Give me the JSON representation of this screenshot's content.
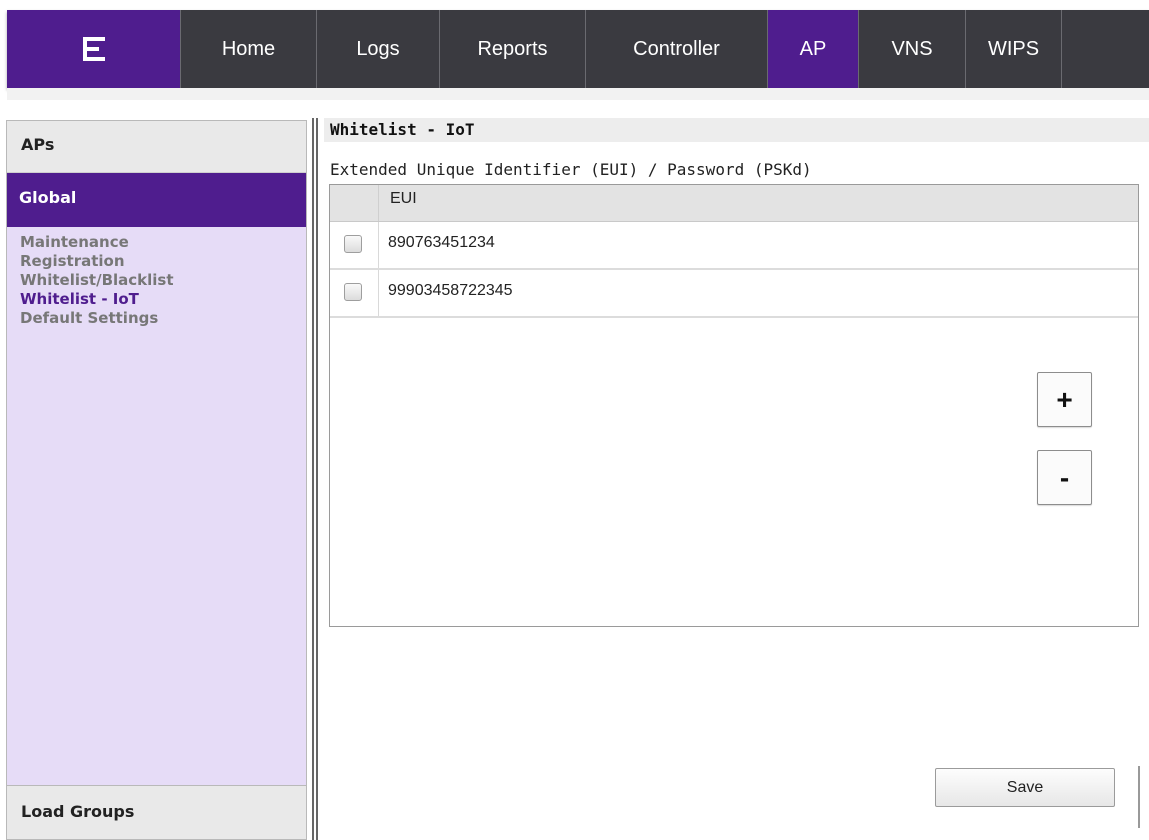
{
  "nav": {
    "logo_icon": "extreme-networks-logo",
    "tabs": [
      {
        "label": "Home",
        "active": false
      },
      {
        "label": "Logs",
        "active": false
      },
      {
        "label": "Reports",
        "active": false
      },
      {
        "label": "Controller",
        "active": false
      },
      {
        "label": "AP",
        "active": true
      },
      {
        "label": "VNS",
        "active": false
      },
      {
        "label": "WIPS",
        "active": false
      }
    ],
    "colors": {
      "bar": "#3a3a40",
      "accent": "#4f1d8e"
    }
  },
  "sidebar": {
    "section_title": "APs",
    "group_title": "Global",
    "items": [
      {
        "label": "Maintenance",
        "active": false
      },
      {
        "label": "Registration",
        "active": false
      },
      {
        "label": "Whitelist/Blacklist",
        "active": false
      },
      {
        "label": "Whitelist - IoT",
        "active": true
      },
      {
        "label": "Default Settings",
        "active": false
      }
    ],
    "footer_title": "Load Groups"
  },
  "main": {
    "page_title": "Whitelist - IoT",
    "section_label": "Extended Unique Identifier (EUI) / Password (PSKd)",
    "table": {
      "columns": [
        "EUI"
      ],
      "rows": [
        {
          "checked": false,
          "eui": "890763451234"
        },
        {
          "checked": false,
          "eui": "99903458722345"
        }
      ]
    },
    "add_label": "+",
    "remove_label": "-",
    "save_label": "Save"
  }
}
